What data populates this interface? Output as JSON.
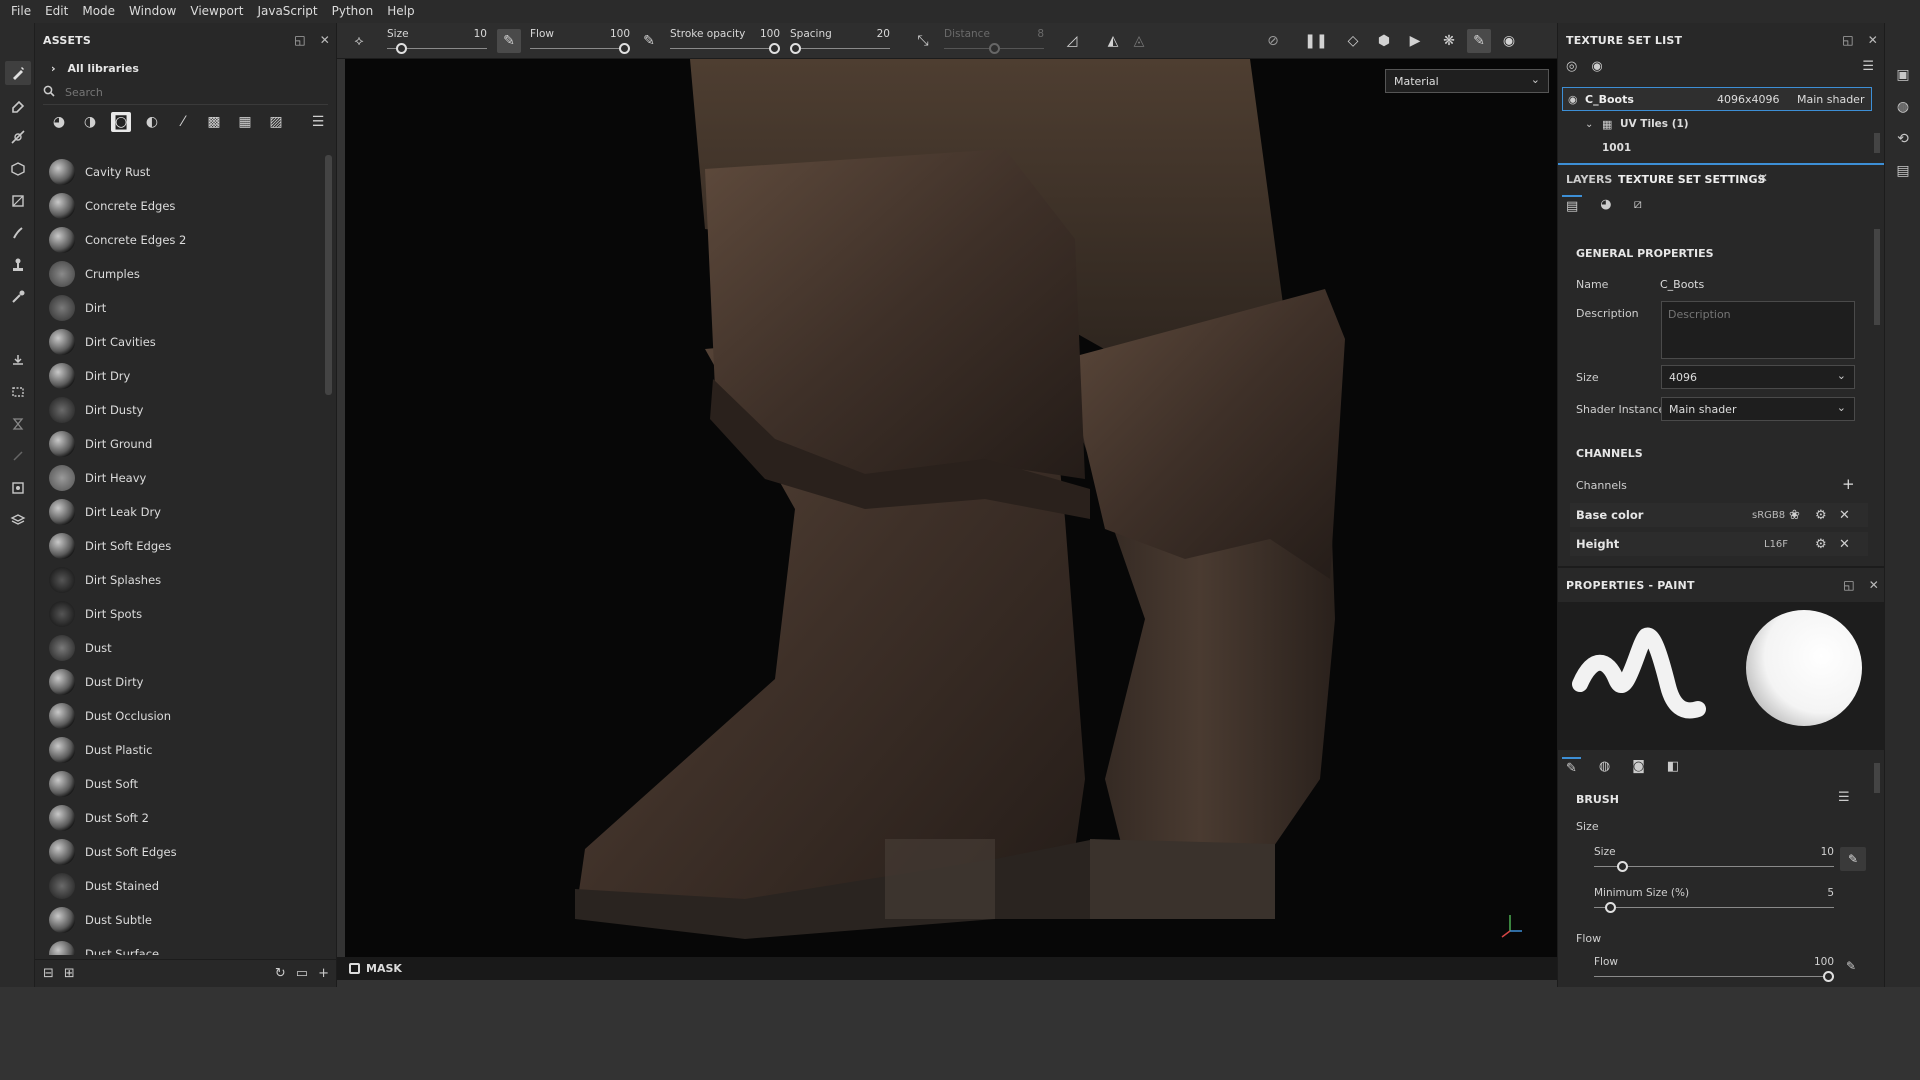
{
  "menu": [
    "File",
    "Edit",
    "Mode",
    "Window",
    "Viewport",
    "JavaScript",
    "Python",
    "Help"
  ],
  "assets": {
    "title": "ASSETS",
    "library": "All libraries",
    "search_placeholder": "Search",
    "items": [
      "Cavity Rust",
      "Concrete Edges",
      "Concrete Edges 2",
      "Crumples",
      "Dirt",
      "Dirt Cavities",
      "Dirt Dry",
      "Dirt Dusty",
      "Dirt Ground",
      "Dirt Heavy",
      "Dirt Leak Dry",
      "Dirt Soft Edges",
      "Dirt Splashes",
      "Dirt Spots",
      "Dust",
      "Dust Dirty",
      "Dust Occlusion",
      "Dust Plastic",
      "Dust Soft",
      "Dust Soft 2",
      "Dust Soft Edges",
      "Dust Stained",
      "Dust Subtle",
      "Dust Surface"
    ]
  },
  "toolbar": {
    "size": {
      "label": "Size",
      "value": "10",
      "fraction": 0.1
    },
    "flow": {
      "label": "Flow",
      "value": "100",
      "fraction": 1.0
    },
    "stroke_opacity": {
      "label": "Stroke opacity",
      "value": "100",
      "fraction": 1.0
    },
    "spacing": {
      "label": "Spacing",
      "value": "20",
      "fraction": 0.0
    },
    "distance": {
      "label": "Distance",
      "value": "8",
      "fraction": 0.5
    }
  },
  "viewport": {
    "mode": "Material",
    "footer_label": "MASK"
  },
  "texture_set_list": {
    "title": "TEXTURE SET LIST",
    "set_name": "C_Boots",
    "set_resolution": "4096x4096",
    "set_shader": "Main shader",
    "uv_tiles": "UV Tiles (1)",
    "tile_id": "1001"
  },
  "tabs": {
    "layers": "LAYERS",
    "texture_set_settings": "TEXTURE SET SETTINGS"
  },
  "general": {
    "title": "GENERAL PROPERTIES",
    "name_label": "Name",
    "name_value": "C_Boots",
    "description_label": "Description",
    "description_placeholder": "Description",
    "size_label": "Size",
    "size_value": "4096",
    "shader_label": "Shader Instance",
    "shader_value": "Main shader"
  },
  "channels": {
    "title": "CHANNELS",
    "label": "Channels",
    "items": [
      {
        "name": "Base color",
        "format": "sRGB8"
      },
      {
        "name": "Height",
        "format": "L16F"
      }
    ]
  },
  "properties": {
    "title": "PROPERTIES - PAINT",
    "brush_title": "BRUSH",
    "size_group": "Size",
    "size": {
      "label": "Size",
      "value": "10",
      "fraction": 0.1
    },
    "min_size": {
      "label": "Minimum Size (%)",
      "value": "5",
      "fraction": 0.05
    },
    "flow_group": "Flow",
    "flow": {
      "label": "Flow",
      "value": "100",
      "fraction": 1.0
    }
  },
  "colors": {
    "accent": "#3d8fd6",
    "panel_bg": "#282828",
    "viewport_bg": "#070707"
  }
}
